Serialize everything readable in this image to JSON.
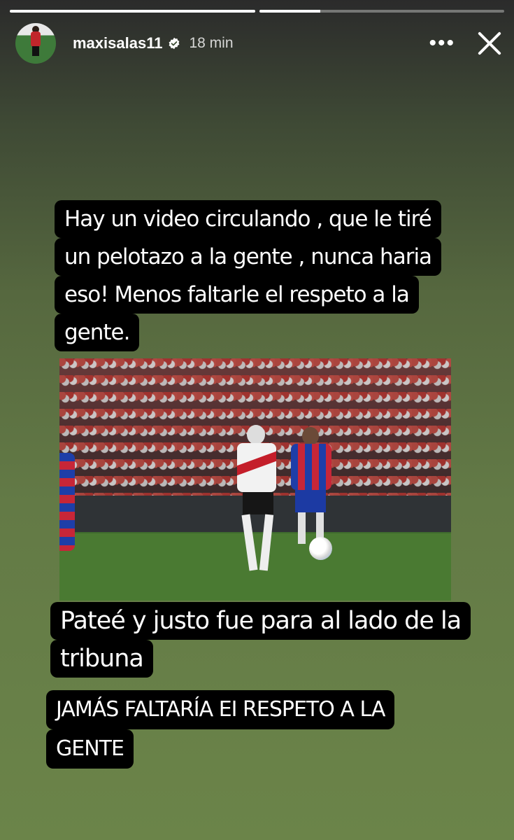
{
  "story": {
    "progress": [
      1.0,
      0.25
    ],
    "username": "maxisalas11",
    "time": "18 min",
    "more_label": "•••"
  },
  "captions": {
    "top": [
      "Hay un video circulando  , que le tiré",
      "un pelotazo a la gente , nunca haria",
      "eso! Menos faltarle el respeto a la",
      "gente."
    ],
    "middle": [
      "Pateé y justo fue para al lado de la",
      "tribuna"
    ],
    "bottom": [
      "JAMÁS FALTARÍA EI RESPETO A LA",
      "GENTE"
    ]
  },
  "colors": {
    "verified_badge": "#ffffff",
    "caption_bg": "#000000"
  },
  "icons": {
    "verified": "verified-badge-icon",
    "more": "more-options-icon",
    "close": "close-icon"
  }
}
